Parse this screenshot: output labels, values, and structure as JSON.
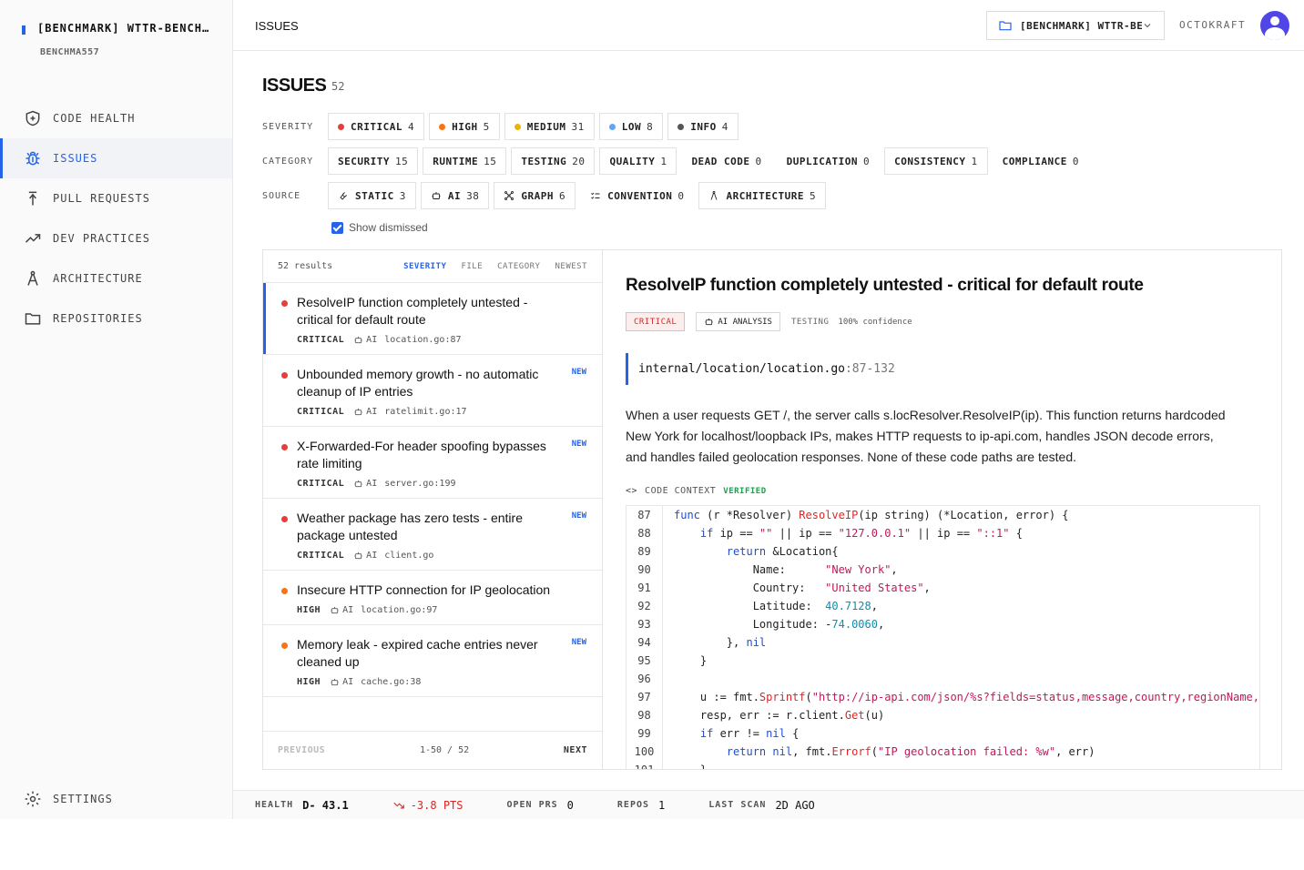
{
  "workspace": {
    "name": "[BENCHMARK] WTTR-BENCHMARK",
    "sub": "BENCHMA557"
  },
  "nav": {
    "items": [
      {
        "label": "CODE HEALTH",
        "icon": "shield-plus-icon"
      },
      {
        "label": "ISSUES",
        "icon": "bug-icon",
        "active": true
      },
      {
        "label": "PULL REQUESTS",
        "icon": "merge-icon"
      },
      {
        "label": "DEV PRACTICES",
        "icon": "trend-up-icon"
      },
      {
        "label": "ARCHITECTURE",
        "icon": "compass-icon"
      },
      {
        "label": "REPOSITORIES",
        "icon": "folder-icon"
      }
    ],
    "settings": "SETTINGS"
  },
  "header": {
    "breadcrumb": "ISSUES",
    "repo_select": "[BENCHMARK] WTTR-BENCHMARK",
    "org": "OCTOKRAFT"
  },
  "page": {
    "title": "ISSUES",
    "count": "52"
  },
  "filters": {
    "severity_label": "SEVERITY",
    "severity": [
      {
        "label": "CRITICAL",
        "count": "4",
        "color": "#e53e3e"
      },
      {
        "label": "HIGH",
        "count": "5",
        "color": "#f97316"
      },
      {
        "label": "MEDIUM",
        "count": "31",
        "color": "#eab308"
      },
      {
        "label": "LOW",
        "count": "8",
        "color": "#60a5fa"
      },
      {
        "label": "INFO",
        "count": "4",
        "color": "#555555"
      }
    ],
    "category_label": "CATEGORY",
    "category": [
      {
        "label": "SECURITY",
        "count": "15"
      },
      {
        "label": "RUNTIME",
        "count": "15"
      },
      {
        "label": "TESTING",
        "count": "20"
      },
      {
        "label": "QUALITY",
        "count": "1"
      },
      {
        "label": "DEAD CODE",
        "count": "0"
      },
      {
        "label": "DUPLICATION",
        "count": "0"
      },
      {
        "label": "CONSISTENCY",
        "count": "1"
      },
      {
        "label": "COMPLIANCE",
        "count": "0"
      }
    ],
    "source_label": "SOURCE",
    "source": [
      {
        "label": "STATIC",
        "count": "3",
        "icon": "wrench-icon"
      },
      {
        "label": "AI",
        "count": "38",
        "icon": "robot-icon"
      },
      {
        "label": "GRAPH",
        "count": "6",
        "icon": "graph-icon"
      },
      {
        "label": "CONVENTION",
        "count": "0",
        "icon": "checklist-icon"
      },
      {
        "label": "ARCHITECTURE",
        "count": "5",
        "icon": "compass-icon"
      }
    ],
    "show_dismissed": "Show dismissed"
  },
  "list": {
    "results": "52 results",
    "sorts": [
      "SEVERITY",
      "FILE",
      "CATEGORY",
      "NEWEST"
    ],
    "items": [
      {
        "title": "ResolveIP function completely untested - critical for default route",
        "severity": "CRITICAL",
        "source": "AI",
        "file": "location.go:87",
        "new": "",
        "color": "#e53e3e"
      },
      {
        "title": "Unbounded memory growth - no automatic cleanup of IP entries",
        "severity": "CRITICAL",
        "source": "AI",
        "file": "ratelimit.go:17",
        "new": "NEW",
        "color": "#e53e3e"
      },
      {
        "title": "X-Forwarded-For header spoofing bypasses rate limiting",
        "severity": "CRITICAL",
        "source": "AI",
        "file": "server.go:199",
        "new": "NEW",
        "color": "#e53e3e"
      },
      {
        "title": "Weather package has zero tests - entire package untested",
        "severity": "CRITICAL",
        "source": "AI",
        "file": "client.go",
        "new": "NEW",
        "color": "#e53e3e"
      },
      {
        "title": "Insecure HTTP connection for IP geolocation",
        "severity": "HIGH",
        "source": "AI",
        "file": "location.go:97",
        "new": "",
        "color": "#f97316"
      },
      {
        "title": "Memory leak - expired cache entries never cleaned up",
        "severity": "HIGH",
        "source": "AI",
        "file": "cache.go:38",
        "new": "NEW",
        "color": "#f97316"
      }
    ],
    "pager": {
      "prev": "PREVIOUS",
      "range": "1-50 / 52",
      "next": "NEXT"
    }
  },
  "detail": {
    "title": "ResolveIP function completely untested - critical for default route",
    "severity": "CRITICAL",
    "source": "AI ANALYSIS",
    "category": "TESTING",
    "confidence": "100% confidence",
    "file": "internal/location/location.go",
    "range": ":87-132",
    "description": "When a user requests GET /, the server calls s.locResolver.ResolveIP(ip). This function returns hardcoded New York for localhost/loopback IPs, makes HTTP requests to ip-api.com, handles JSON decode errors, and handles failed geolocation responses. None of these code paths are tested.",
    "context_label": "CODE CONTEXT",
    "verified": "VERIFIED",
    "line_numbers": [
      "87",
      "88",
      "89",
      "90",
      "91",
      "92",
      "93",
      "94",
      "95",
      "96",
      "97",
      "98",
      "99",
      "100",
      "101"
    ]
  },
  "status": {
    "health_label": "HEALTH",
    "health": "D- 43.1",
    "delta": "-3.8 PTS",
    "open_prs_label": "OPEN PRS",
    "open_prs": "0",
    "repos_label": "REPOS",
    "repos": "1",
    "last_scan_label": "LAST SCAN",
    "last_scan": "2D AGO"
  }
}
